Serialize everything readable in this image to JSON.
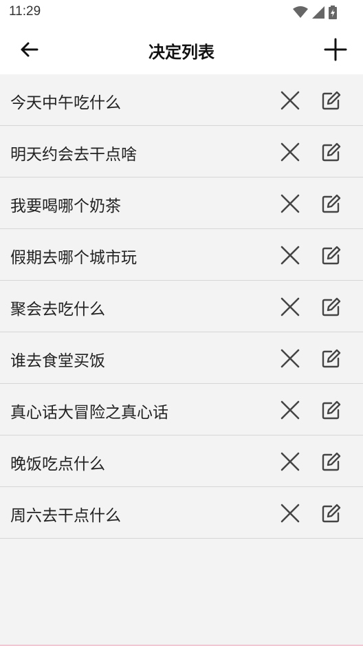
{
  "status_bar": {
    "time": "11:29"
  },
  "app_bar": {
    "title": "决定列表"
  },
  "decisions": [
    {
      "label": "今天中午吃什么"
    },
    {
      "label": "明天约会去干点啥"
    },
    {
      "label": "我要喝哪个奶茶"
    },
    {
      "label": "假期去哪个城市玩"
    },
    {
      "label": "聚会去吃什么"
    },
    {
      "label": "谁去食堂买饭"
    },
    {
      "label": "真心话大冒险之真心话"
    },
    {
      "label": "晚饭吃点什么"
    },
    {
      "label": "周六去干点什么"
    }
  ],
  "colors": {
    "background": "#f3f3f3",
    "appbar": "#ffffff",
    "divider": "#d6d6d6",
    "icon": "#444444"
  }
}
